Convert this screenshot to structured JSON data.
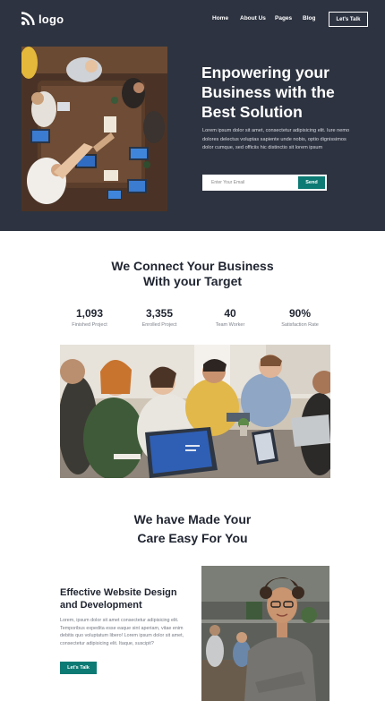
{
  "nav": {
    "logo_text": "logo",
    "menu": [
      "Home",
      "About Us",
      "Pages",
      "Blog"
    ],
    "cta": "Let's Talk"
  },
  "hero": {
    "title": "Enpowering your Business with the Best Solution",
    "body": "Lorem ipsum dolor sit amet, consectetur adipisicing elit. Iure nemo dolores delectus voluptas sapiente unde nobis, optio dignissimos dolor cumque, sed officiis hic distinctio sit lorem ipsum",
    "email_placeholder": "Enter Your Email",
    "send_label": "Send"
  },
  "connect": {
    "title_line1": "We Connect Your Business",
    "title_line2": "With your Target",
    "stats": [
      {
        "value": "1,093",
        "label": "Finished Project"
      },
      {
        "value": "3,355",
        "label": "Enrolled Project"
      },
      {
        "value": "40",
        "label": "Team Worker"
      },
      {
        "value": "90%",
        "label": "Satisfaction Rate"
      }
    ]
  },
  "care": {
    "title_line1": "We have Made Your",
    "title_line2": "Care Easy For You",
    "feature_title": "Effective Website Design and Development",
    "feature_text": "Lorem, ipsum dolor sit amet consectetur adipisicing elit. Temporibus expedita esse eaque sint aperiam, vitae enim debitis quo voluptatum libero! Lorem ipsum dolor sit amet, consectetur adipisicing elit. Itaque, suscipit?",
    "feature_cta": "Let's Talk"
  },
  "colors": {
    "hero_bg": "#2d3340",
    "accent": "#0d7a73",
    "heading": "#1f2430"
  }
}
